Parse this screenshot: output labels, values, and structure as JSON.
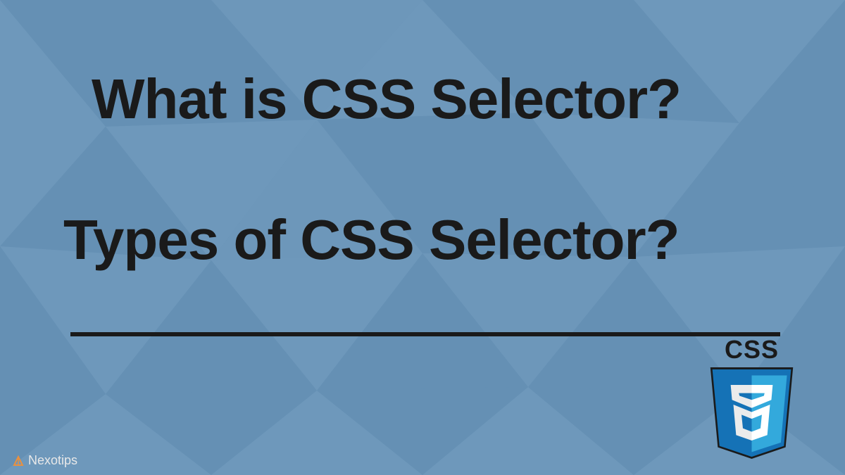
{
  "title1": "What is CSS Selector?",
  "title2": "Types of CSS Selector?",
  "logo": {
    "text": "CSS",
    "number": "3"
  },
  "brand": {
    "name": "Nexotips"
  }
}
